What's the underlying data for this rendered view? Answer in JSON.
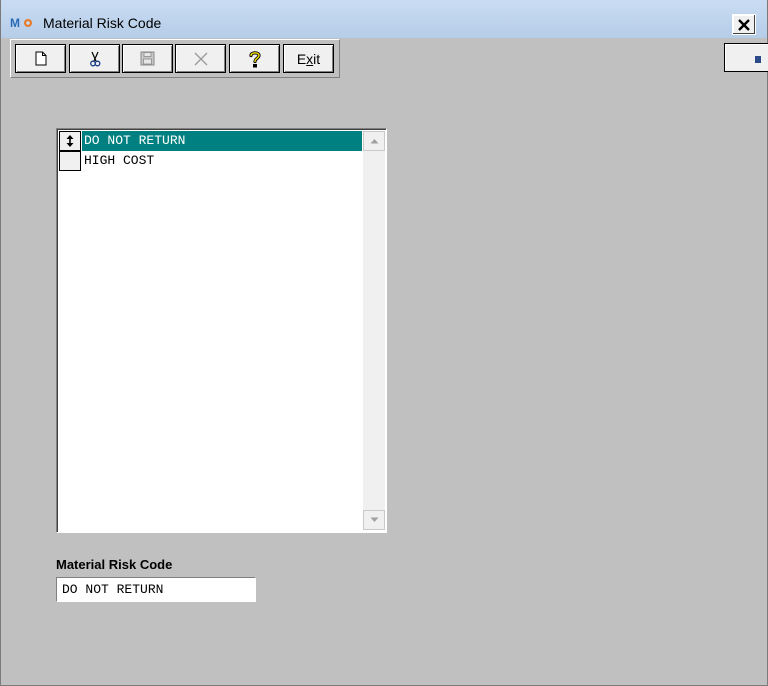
{
  "window": {
    "title": "Material Risk Code",
    "close_label": "×"
  },
  "toolbar": {
    "exit_label_prefix": "E",
    "exit_label_underline": "x",
    "exit_label_suffix": "it"
  },
  "grid": {
    "rows": [
      {
        "value": "DO NOT RETURN",
        "selected": true
      },
      {
        "value": "HIGH COST",
        "selected": false
      }
    ]
  },
  "form": {
    "field_label": "Material Risk Code",
    "field_value": "DO NOT RETURN"
  },
  "colors": {
    "selection": "#008080",
    "background": "#c0c0c0"
  }
}
